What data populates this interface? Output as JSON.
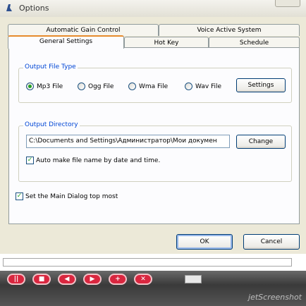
{
  "window": {
    "title": "Options"
  },
  "tabs": {
    "row_back": [
      "Automatic Gain Control",
      "Voice Active System"
    ],
    "row_front": [
      "General Settings",
      "Hot Key",
      "Schedule"
    ]
  },
  "output_file_type": {
    "label": "Output File Type",
    "options": [
      "Mp3 File",
      "Ogg File",
      "Wma File",
      "Wav File"
    ],
    "selected": "Mp3 File",
    "settings_button": "Settings"
  },
  "output_directory": {
    "label": "Output Directory",
    "path": "C:\\Documents and Settings\\Администратор\\Мои докумен",
    "change_button": "Change",
    "auto_name_checkbox": "Auto make file name by date and time.",
    "auto_name_checked": true
  },
  "top_most_checkbox": "Set the Main Dialog top most",
  "top_most_checked": true,
  "buttons": {
    "ok": "OK",
    "cancel": "Cancel"
  },
  "watermark": "jetScreenshot",
  "media_buttons": [
    "pause",
    "stop",
    "rewind",
    "forward",
    "add",
    "delete"
  ]
}
